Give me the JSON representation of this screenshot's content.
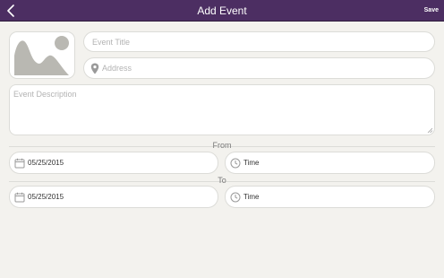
{
  "header": {
    "title": "Add Event",
    "save_label": "Save"
  },
  "form": {
    "title_placeholder": "Event Title",
    "address_placeholder": "Address",
    "description_placeholder": "Event Description",
    "from_label": "From",
    "to_label": "To",
    "from_date": "05/25/2015",
    "from_time": "Time",
    "to_date": "05/25/2015",
    "to_time": "Time"
  },
  "icons": {
    "back": "chevron-left-icon",
    "photo": "image-placeholder-icon",
    "location": "map-pin-icon",
    "calendar": "calendar-icon",
    "clock": "clock-icon"
  },
  "colors": {
    "header_bg": "#4c2e62",
    "page_bg": "#f3f2ee",
    "placeholder_text": "#b3b3b3"
  }
}
